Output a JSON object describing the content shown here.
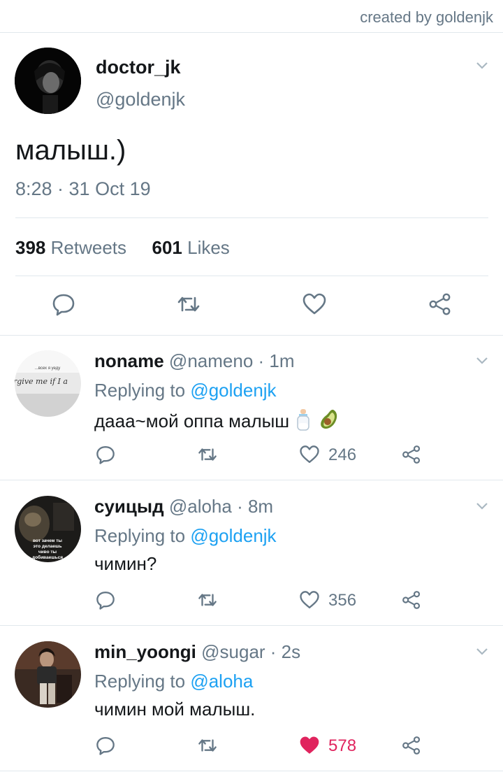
{
  "credit": "created by goldenjk",
  "tweet": {
    "display_name": "doctor_jk",
    "handle": "@goldenjk",
    "text": "малыш.)",
    "timestamp": "8:28 · 31 Oct 19",
    "retweets_count": "398",
    "retweets_label": "Retweets",
    "likes_count": "601",
    "likes_label": "Likes",
    "avatar_icon": "avatar-photo"
  },
  "replies": [
    {
      "display_name": "noname",
      "meta": "@nameno · 1m",
      "replying_prefix": "Replying to",
      "replying_to": "@goldenjk",
      "text": "дааа~мой оппа малыш",
      "emojis": [
        "baby-bottle-icon",
        "avocado-icon"
      ],
      "like_count": "246",
      "liked": false,
      "avatar_caption_top": "...всех я уеду",
      "avatar_caption": "rgive me if I a"
    },
    {
      "display_name": "суицыд",
      "meta": "@aloha · 8m",
      "replying_prefix": "Replying to",
      "replying_to": "@goldenjk",
      "text": "чимин?",
      "like_count": "356",
      "liked": false,
      "avatar_caption": "вот зачем ты это делаешь чиво ты добиваешься"
    },
    {
      "display_name": "min_yoongi",
      "meta": "@sugar · 2s",
      "replying_prefix": "Replying to",
      "replying_to": "@aloha",
      "text": "чимин мой малыш.",
      "like_count": "578",
      "liked": true
    }
  ],
  "colors": {
    "secondary_text": "#657786",
    "link": "#1da1f2",
    "like_active": "#e0245e",
    "divider": "#e1e8ed"
  }
}
